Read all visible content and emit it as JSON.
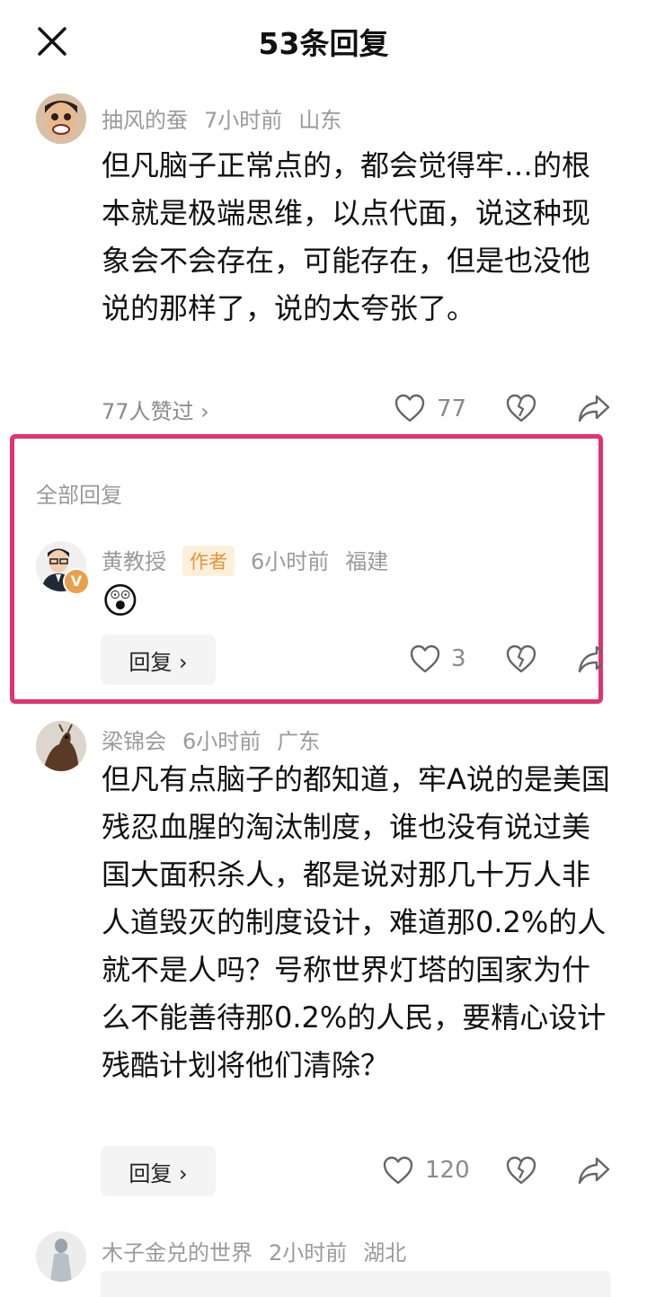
{
  "header": {
    "title": "53条回复"
  },
  "top_comment": {
    "username": "抽风的蚕",
    "time": "7小时前",
    "location": "山东",
    "text": "但凡脑子正常点的，都会觉得牢…的根本就是极端思维，以点代面，说这种现象会不会存在，可能存在，但是也没他说的那样了，说的太夸张了。",
    "liked_by": "77人赞过 ›",
    "likes": "77"
  },
  "replies_section": {
    "label": "全部回复"
  },
  "author_reply": {
    "username": "黄教授",
    "badge": "作者",
    "time": "6小时前",
    "location": "福建",
    "emoji": "😲",
    "reply_label": "回复 ›",
    "likes": "3"
  },
  "comment_2": {
    "username": "梁锦会",
    "time": "6小时前",
    "location": "广东",
    "text": "但凡有点脑子的都知道，牢A说的是美国残忍血腥的淘汰制度，谁也没有说过美国大面积杀人，都是说对那几十万人非人道毁灭的制度设计，难道那0.2%的人就不是人吗？号称世界灯塔的国家为什么不能善待那0.2%的人民，要精心设计残酷计划将他们清除？",
    "reply_label": "回复 ›",
    "likes": "120"
  },
  "comment_3": {
    "username": "木子金兑的世界",
    "time": "2小时前",
    "location": "湖北"
  },
  "icons": {
    "close": "close-icon",
    "like": "heart-icon",
    "dislike": "broken-heart-icon",
    "share": "share-icon"
  },
  "colors": {
    "highlight_border": "#e0336f",
    "author_badge_bg": "#fdf0db",
    "author_badge_text": "#e0963a",
    "verified_badge": "#e9a04a"
  }
}
